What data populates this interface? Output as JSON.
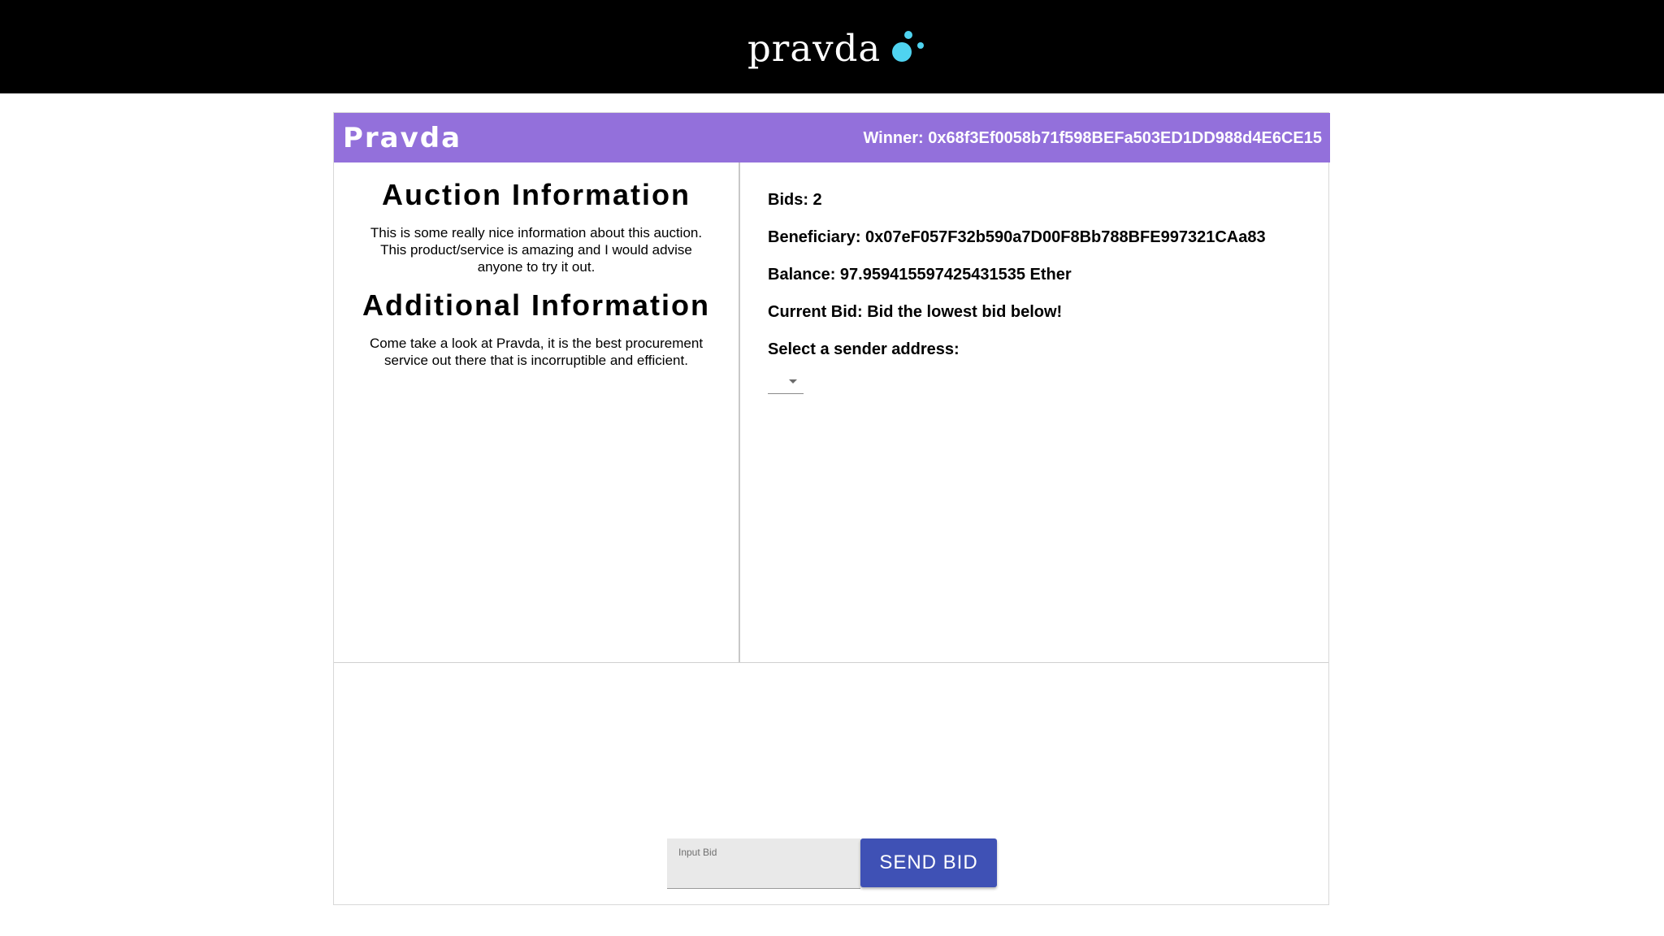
{
  "topbar": {
    "logo_text": "pravda"
  },
  "card": {
    "brand_title": "Pravda",
    "winner_text": "Winner: 0x68f3Ef0058b71f598BEFa503ED1DD988d4E6CE15"
  },
  "left": {
    "auction_heading": "Auction Information",
    "auction_text": "This is some really nice information about this auction. This product/service is amazing and I would advise anyone to try it out.",
    "additional_heading": "Additional Information",
    "additional_text": "Come take a look at Pravda, it is the best procurement service out there that is incorruptible and efficient."
  },
  "right": {
    "bids": "Bids: 2",
    "beneficiary": "Beneficiary: 0x07eF057F32b590a7D00F8Bb788BFE997321CAa83",
    "balance": "Balance: 97.959415597425431535 Ether",
    "current_bid": "Current Bid: Bid the lowest bid below!",
    "select_label": "Select a sender address:",
    "select_value": ""
  },
  "bid_form": {
    "input_label": "Input Bid",
    "input_value": "",
    "send_label": "SEND BID"
  },
  "colors": {
    "topbar": "#000000",
    "header": "#9370db",
    "button": "#3f51b5",
    "logo_dot": "#4fd3f0"
  }
}
